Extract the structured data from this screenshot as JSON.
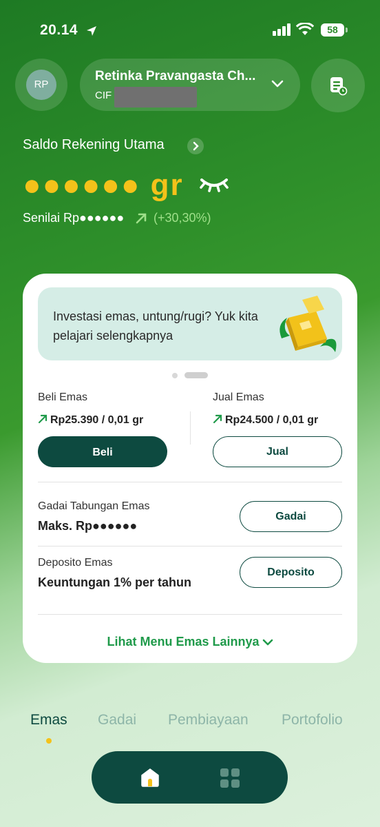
{
  "status_bar": {
    "time": "20.14",
    "battery": "58"
  },
  "header": {
    "avatar_initials": "RP",
    "account_name": "Retinka Pravangasta Ch...",
    "cif_label": "CIF"
  },
  "balance": {
    "label": "Saldo Rekening Utama",
    "value": "●●●●●● gr",
    "equivalent": "Senilai Rp●●●●●●",
    "change": "(+30,30%)"
  },
  "card": {
    "banner_text": "Investasi emas, untung/rugi? Yuk kita pelajari selengkapnya",
    "buy": {
      "label": "Beli Emas",
      "price": "Rp25.390 / 0,01 gr",
      "button": "Beli"
    },
    "sell": {
      "label": "Jual Emas",
      "price": "Rp24.500 / 0,01 gr",
      "button": "Jual"
    },
    "pawn": {
      "label": "Gadai Tabungan Emas",
      "value": "Maks. Rp●●●●●●",
      "button": "Gadai"
    },
    "deposit": {
      "label": "Deposito Emas",
      "value": "Keuntungan 1% per tahun",
      "button": "Deposito"
    },
    "more_link": "Lihat Menu Emas Lainnya"
  },
  "tabs": [
    {
      "label": "Emas",
      "active": true
    },
    {
      "label": "Gadai",
      "active": false
    },
    {
      "label": "Pembiayaan",
      "active": false
    },
    {
      "label": "Portofolio",
      "active": false
    }
  ],
  "bottom_nav": {
    "icons": [
      "home-icon",
      "grid-menu-icon"
    ],
    "active": "home-icon"
  },
  "colors": {
    "brand_green": "#2e8f2a",
    "dark_teal": "#0d4a40",
    "gold": "#f4c21a",
    "link_green": "#1f9a4a",
    "positive": "#9fe08a"
  }
}
